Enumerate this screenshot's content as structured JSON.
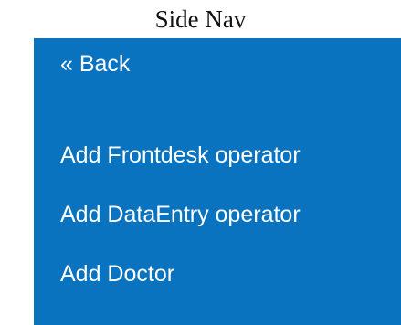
{
  "caption": "Side Nav",
  "sidenav": {
    "back_label": "« Back",
    "items": [
      {
        "label": "Add Frontdesk operator"
      },
      {
        "label": "Add DataEntry operator"
      },
      {
        "label": "Add Doctor"
      }
    ],
    "colors": {
      "background": "#0a73bf",
      "text": "#ffffff"
    }
  }
}
